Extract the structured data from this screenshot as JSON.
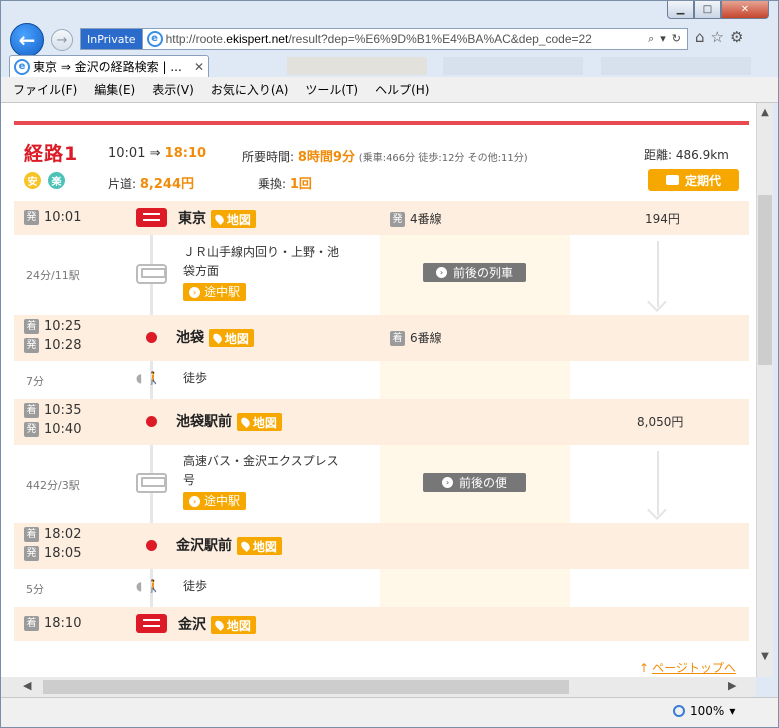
{
  "browser": {
    "inprivate": "InPrivate",
    "url_pre": "http://roote.",
    "url_host": "ekispert.net",
    "url_post": "/result?dep=%E6%9D%B1%E4%BA%AC&dep_code=22",
    "tab_title": "東京 ⇒ 金沢の経路検索 | ...",
    "zoom": "100%"
  },
  "menu": [
    "ファイル(F)",
    "編集(E)",
    "表示(V)",
    "お気に入り(A)",
    "ツール(T)",
    "ヘルプ(H)"
  ],
  "summary": {
    "title": "経路1",
    "badge1": "安",
    "badge2": "楽",
    "dep": "10:01",
    "arrow": "⇒",
    "arr": "18:10",
    "dur_label": "所要時間:",
    "dur": "8時間9分",
    "dur_detail": "(乗車:466分 徒歩:12分 その他:11分)",
    "dist_label": "距離:",
    "dist": "486.9km",
    "fare_label": "片道:",
    "fare": "8,244円",
    "transfer_label": "乗換:",
    "transfer": "1回",
    "teiki": "定期代"
  },
  "labels": {
    "dep": "発",
    "arr": "着",
    "map": "地図",
    "mid": "途中駅",
    "walk": "徒歩",
    "page_top": "ページトップへ"
  },
  "route": {
    "tokyo": {
      "time": "10:01",
      "name": "東京",
      "plat": "4番線",
      "fare": "194円"
    },
    "seg1": {
      "sub": "24分/11駅",
      "line1": "ＪＲ山手線内回り・上野・池",
      "line2": "袋方面",
      "btn": "前後の列車"
    },
    "ikebukuro": {
      "arr": "10:25",
      "dep": "10:28",
      "name": "池袋",
      "plat": "6番線"
    },
    "walk1": {
      "sub": "7分"
    },
    "ikebukuro_st": {
      "arr": "10:35",
      "dep": "10:40",
      "name": "池袋駅前",
      "fare": "8,050円"
    },
    "seg2": {
      "sub": "442分/3駅",
      "line1": "高速バス・金沢エクスプレス",
      "line2": "号",
      "btn": "前後の便"
    },
    "kanazawa_st": {
      "arr": "18:02",
      "dep": "18:05",
      "name": "金沢駅前"
    },
    "walk2": {
      "sub": "5分"
    },
    "kanazawa": {
      "time": "18:10",
      "name": "金沢"
    }
  }
}
